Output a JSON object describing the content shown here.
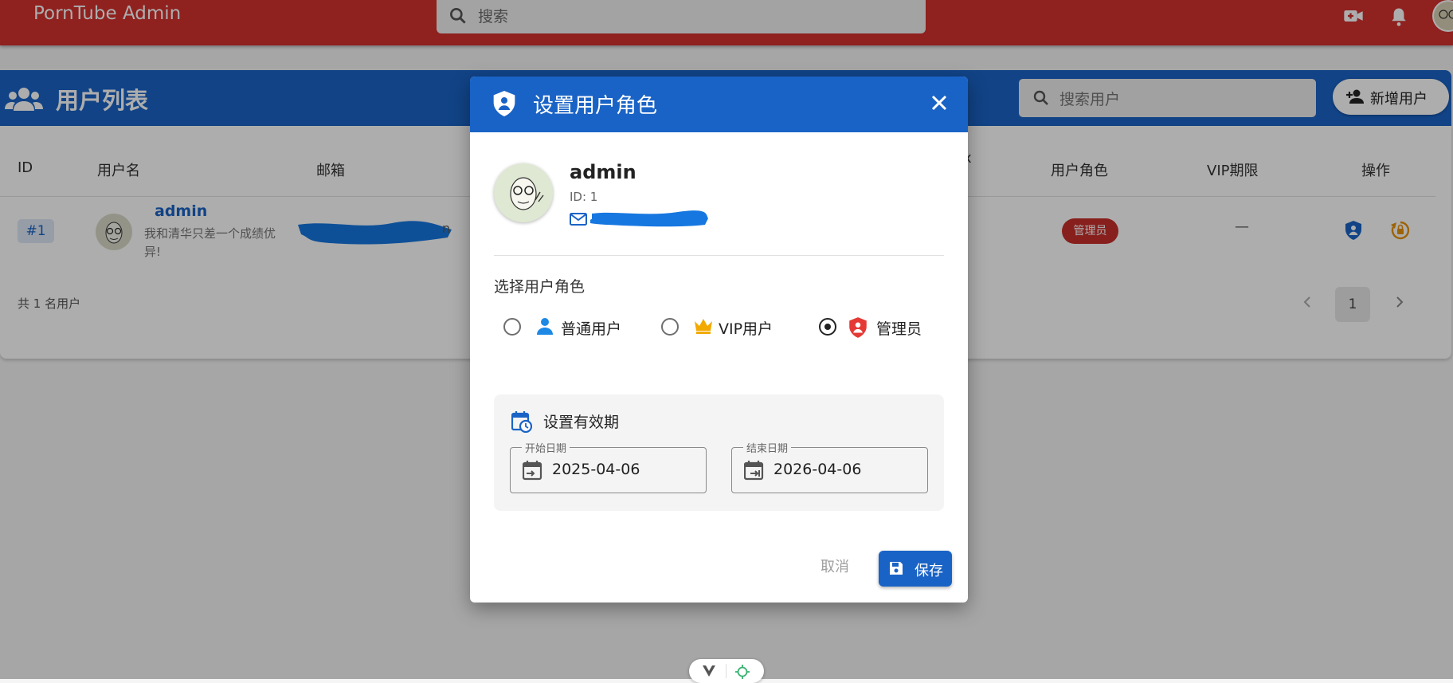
{
  "app": {
    "title": "PornTube Admin",
    "search_placeholder": "搜索"
  },
  "users_panel": {
    "title": "用户列表",
    "search_placeholder": "搜索用户",
    "add_user_label": "新增用户",
    "columns": {
      "id": "ID",
      "username": "用户名",
      "email": "邮箱",
      "partial": "x",
      "role": "用户角色",
      "vip": "VIP期限",
      "actions": "操作"
    },
    "rows": [
      {
        "id": "#1",
        "username": "admin",
        "bio": "我和清华只差一个成绩优异!",
        "email_tail": "n",
        "role": "管理员",
        "vip": "—"
      }
    ],
    "total": "共 1 名用户",
    "page": "1"
  },
  "dialog": {
    "title": "设置用户角色",
    "username": "admin",
    "user_id": "ID: 1",
    "select_role_label": "选择用户角色",
    "roles": [
      {
        "label": "普通用户",
        "icon": "person-icon",
        "selected": false
      },
      {
        "label": "VIP用户",
        "icon": "crown-icon",
        "selected": false
      },
      {
        "label": "管理员",
        "icon": "admin-shield-icon",
        "selected": true
      }
    ],
    "validity_title": "设置有效期",
    "start_label": "开始日期",
    "start_value": "2025-04-06",
    "end_label": "结束日期",
    "end_value": "2026-04-06",
    "cancel_label": "取消",
    "save_label": "保存"
  },
  "colors": {
    "appbar": "#d3322f",
    "primary": "#1a63c6",
    "admin_badge": "#c7302c",
    "crown": "#f2a900",
    "redacted": "#1677e0"
  }
}
